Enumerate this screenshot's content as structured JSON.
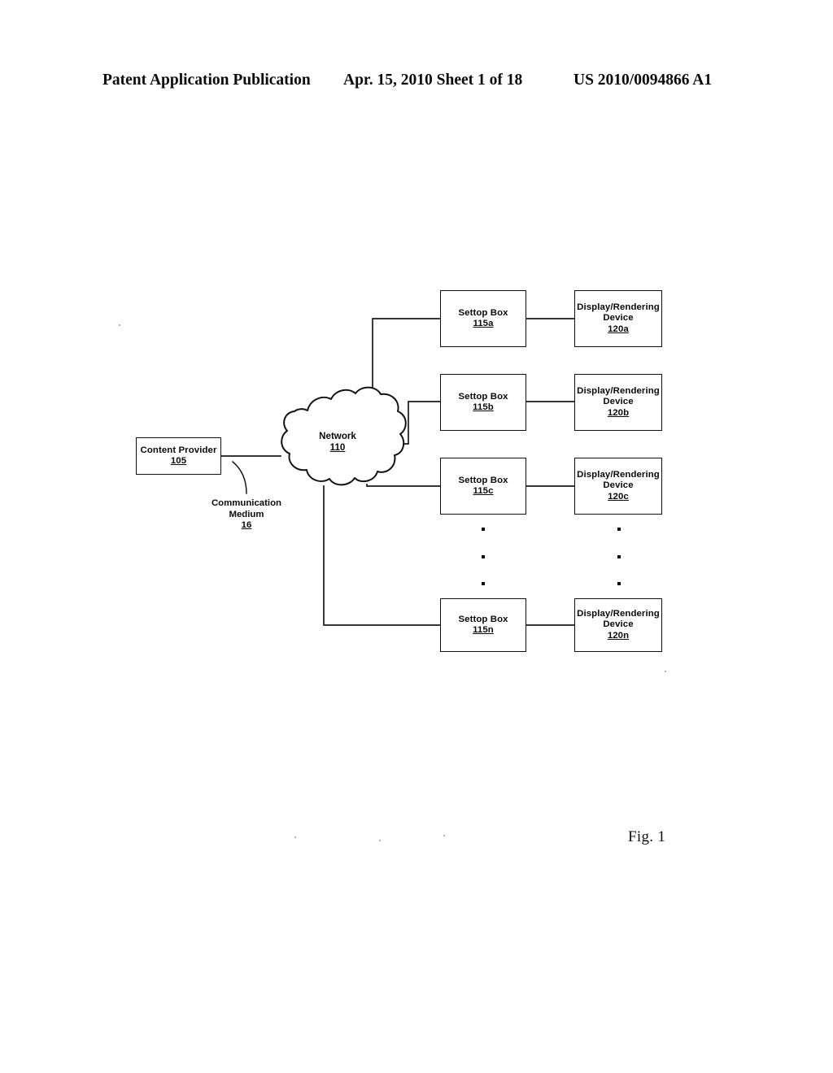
{
  "header": {
    "publication": "Patent Application Publication",
    "date_sheet": "Apr. 15, 2010  Sheet 1 of 18",
    "patent_number": "US 2010/0094866 A1"
  },
  "figure": {
    "caption": "Fig. 1"
  },
  "diagram": {
    "content_provider": {
      "title": "Content Provider",
      "ref": "105"
    },
    "network": {
      "title": "Network",
      "ref": "110"
    },
    "communication_medium": {
      "line1": "Communication",
      "line2": "Medium",
      "ref": "16"
    },
    "settop_boxes": [
      {
        "title": "Settop Box",
        "ref": "115a"
      },
      {
        "title": "Settop Box",
        "ref": "115b"
      },
      {
        "title": "Settop Box",
        "ref": "115c"
      },
      {
        "title": "Settop Box",
        "ref": "115n"
      }
    ],
    "display_devices": [
      {
        "line1": "Display/Rendering",
        "line2": "Device",
        "ref": "120a"
      },
      {
        "line1": "Display/Rendering",
        "line2": "Device",
        "ref": "120b"
      },
      {
        "line1": "Display/Rendering",
        "line2": "Device",
        "ref": "120c"
      },
      {
        "line1": "Display/Rendering",
        "line2": "Device",
        "ref": "120n"
      }
    ]
  },
  "colors": {
    "ink": "#0a0a0a",
    "paper": "#ffffff"
  }
}
